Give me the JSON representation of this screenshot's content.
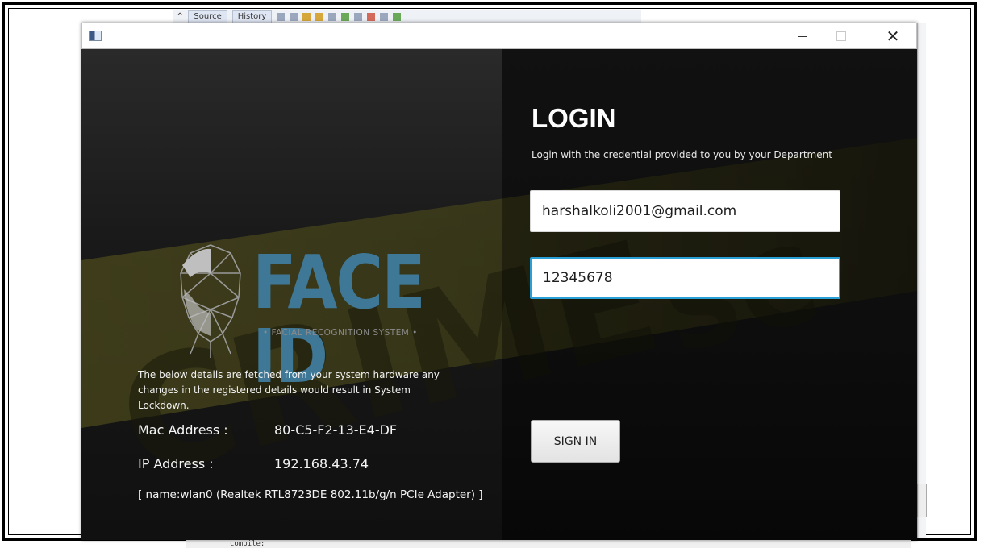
{
  "ide": {
    "tab_source": "Source",
    "tab_history": "History",
    "console_text": "compile:"
  },
  "window": {
    "minimize_icon": "minimize-icon",
    "maximize_icon": "maximize-icon",
    "close_icon": "close-icon",
    "close_glyph": "✕"
  },
  "branding": {
    "logo_text": "FACE ID",
    "logo_sub": "• FACIAL RECOGNITION SYSTEM •",
    "accent": "#3f7897",
    "tape_color": "#6e6a1a"
  },
  "system_info": {
    "notice": "The below details are fetched from your system hardware any changes in the registered details would result in System Lockdown.",
    "mac_label": "Mac Address :",
    "mac_value": "80-C5-F2-13-E4-DF",
    "ip_label": "IP Address   :",
    "ip_value": "192.168.43.74",
    "adapter": "[ name:wlan0 (Realtek RTL8723DE 802.11b/g/n PCIe Adapter) ]"
  },
  "login": {
    "title": "LOGIN",
    "subtitle": "Login with the credential provided to you by your Department",
    "email_value": "harshalkoli2001@gmail.com",
    "password_value": "12345678",
    "focus_color": "#2a9fd6",
    "signin_label": "SIGN IN"
  }
}
